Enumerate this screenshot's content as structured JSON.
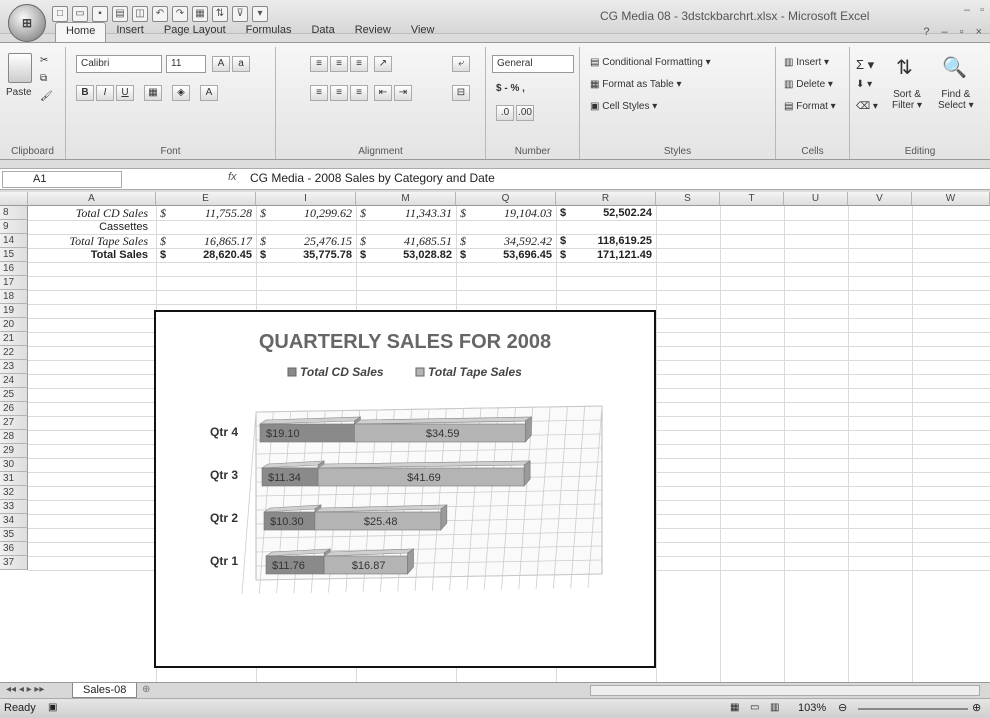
{
  "window": {
    "title": "CG Media 08 - 3dstckbarchrt.xlsx - Microsoft Excel"
  },
  "ribbon_tabs": [
    "Home",
    "Insert",
    "Page Layout",
    "Formulas",
    "Data",
    "Review",
    "View"
  ],
  "ribbon": {
    "clipboard": {
      "paste": "Paste",
      "label": "Clipboard"
    },
    "font": {
      "name": "Calibri",
      "size": "11",
      "label": "Font"
    },
    "alignment": {
      "label": "Alignment"
    },
    "number": {
      "format": "General",
      "label": "Number",
      "currency": "$ - % ,"
    },
    "styles": {
      "conditional": "Conditional Formatting",
      "table": "Format as Table",
      "cell": "Cell Styles",
      "label": "Styles"
    },
    "cells": {
      "insert": "Insert",
      "delete": "Delete",
      "format": "Format",
      "label": "Cells"
    },
    "editing": {
      "sort": "Sort &",
      "filter": "Filter",
      "find": "Find &",
      "select": "Select",
      "label": "Editing"
    }
  },
  "formula_bar": {
    "name_box": "A1",
    "fx": "fx",
    "formula": "CG Media - 2008 Sales by Category and Date"
  },
  "columns": [
    "A",
    "E",
    "I",
    "M",
    "Q",
    "R",
    "S",
    "T",
    "U",
    "V",
    "W"
  ],
  "rows": [
    "8",
    "9",
    "14",
    "15",
    "16",
    "17",
    "18",
    "19",
    "20",
    "21",
    "22",
    "23",
    "24",
    "25",
    "26",
    "27",
    "28",
    "29",
    "30",
    "31",
    "32",
    "33",
    "34",
    "35",
    "36",
    "37"
  ],
  "sheet": {
    "r8": {
      "label": "Total CD Sales",
      "e": "11,755.28",
      "i": "10,299.62",
      "m": "11,343.31",
      "q": "19,104.03",
      "r": "52,502.24"
    },
    "r9": {
      "label": "Cassettes"
    },
    "r14": {
      "label": "Total Tape Sales",
      "e": "16,865.17",
      "i": "25,476.15",
      "m": "41,685.51",
      "q": "34,592.42",
      "r": "118,619.25"
    },
    "r15": {
      "label": "Total Sales",
      "e": "28,620.45",
      "i": "35,775.78",
      "m": "53,028.82",
      "q": "53,696.45",
      "r": "171,121.49"
    },
    "currency": "$"
  },
  "chart_data": {
    "type": "bar",
    "title": "QUARTERLY SALES FOR 2008",
    "categories": [
      "Qtr 4",
      "Qtr 3",
      "Qtr 2",
      "Qtr 1"
    ],
    "series": [
      {
        "name": "Total CD Sales",
        "values": [
          19.1,
          11.34,
          10.3,
          11.76
        ],
        "labels": [
          "$19.10",
          "$11.34",
          "$10.30",
          "$11.76"
        ],
        "color": "#8a8a8a"
      },
      {
        "name": "Total Tape Sales",
        "values": [
          34.59,
          41.69,
          25.48,
          16.87
        ],
        "labels": [
          "$34.59",
          "$41.69",
          "$25.48",
          "$16.87"
        ],
        "color": "#b4b4b4"
      }
    ],
    "stacked": true,
    "legend": "top",
    "grid": true
  },
  "sheet_tab": "Sales-08",
  "status": {
    "ready": "Ready",
    "zoom": "103%"
  }
}
